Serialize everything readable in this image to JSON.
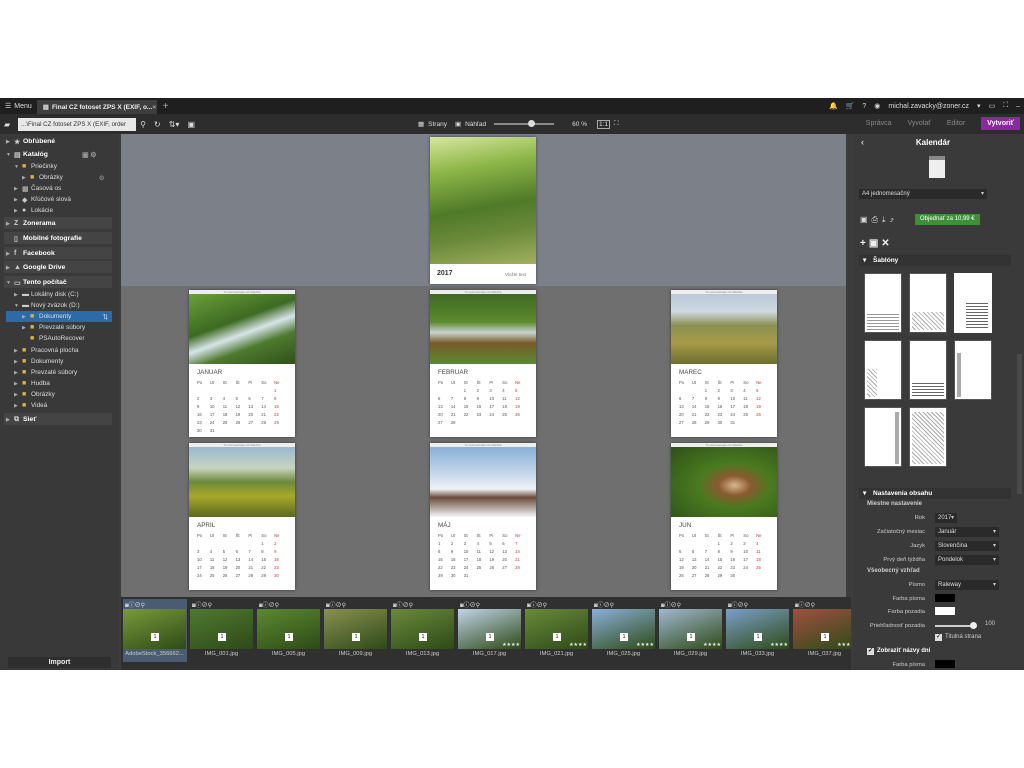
{
  "topbar": {
    "menu_label": "Menu",
    "tab_title": "Final CZ fotoset ZPS X (EXIF, o...",
    "user_email": "michal.zavacky@zoner.cz"
  },
  "toolbar": {
    "path": "...\\Final CZ fotoset ZPS X (EXIF, order",
    "pages_label": "Strany",
    "preview_label": "Náhľad",
    "zoom": "60 %",
    "modes": [
      "Správca",
      "Vyvolať",
      "Editor"
    ],
    "create_label": "Vytvoriť"
  },
  "navigator": {
    "favorites": "Obľúbené",
    "catalog": "Katalóg",
    "folders": "Priečinky",
    "pictures_sub": "Obrázky",
    "timeline": "Časová os",
    "keywords": "Kľúčové slová",
    "locations": "Lokácie",
    "zonerama": "Zonerama",
    "mobile": "Mobilné fotografie",
    "facebook": "Facebook",
    "gdrive": "Google Drive",
    "computer": "Tento počítač",
    "disk_c": "Lokálny disk (C:)",
    "new_volume": "Nový zväzok (D:)",
    "documents_sel": "Dokumenty",
    "downloads_sub": "Prevzaté súbory",
    "psauto": "PSAutoRecover",
    "desktop": "Pracovná plocha",
    "documents": "Dokumenty",
    "downloads": "Prevzaté súbory",
    "music": "Hudba",
    "pictures": "Obrázky",
    "videos": "Videá",
    "network": "Sieť",
    "import": "Import"
  },
  "calendar": {
    "cover_year": "2017",
    "cover_text": "Vložte text",
    "header_note": "Tu nezmestrujte nič dôležité",
    "weekdays": [
      "Po",
      "Ut",
      "St",
      "Št",
      "Pi",
      "So",
      "Ne"
    ],
    "months": [
      {
        "name": "JANUAR",
        "days": [
          "",
          "",
          "",
          "",
          "",
          "",
          "1",
          "2",
          "3",
          "4",
          "5",
          "6",
          "7",
          "8",
          "9",
          "10",
          "11",
          "12",
          "13",
          "14",
          "15",
          "16",
          "17",
          "18",
          "19",
          "20",
          "21",
          "22",
          "23",
          "24",
          "25",
          "26",
          "27",
          "28",
          "29",
          "30",
          "31"
        ]
      },
      {
        "name": "FEBRUAR",
        "days": [
          "",
          "",
          "1",
          "2",
          "3",
          "4",
          "5",
          "6",
          "7",
          "8",
          "9",
          "10",
          "11",
          "12",
          "13",
          "14",
          "15",
          "16",
          "17",
          "18",
          "19",
          "20",
          "21",
          "22",
          "23",
          "24",
          "25",
          "26",
          "27",
          "28"
        ]
      },
      {
        "name": "MAREC",
        "days": [
          "",
          "",
          "1",
          "2",
          "3",
          "4",
          "5",
          "6",
          "7",
          "8",
          "9",
          "10",
          "11",
          "12",
          "13",
          "14",
          "15",
          "16",
          "17",
          "18",
          "19",
          "20",
          "21",
          "22",
          "23",
          "24",
          "25",
          "26",
          "27",
          "28",
          "29",
          "30",
          "31"
        ]
      },
      {
        "name": "APRIL",
        "days": [
          "",
          "",
          "",
          "",
          "",
          "1",
          "2",
          "3",
          "4",
          "5",
          "6",
          "7",
          "8",
          "9",
          "10",
          "11",
          "12",
          "13",
          "14",
          "15",
          "16",
          "17",
          "18",
          "19",
          "20",
          "21",
          "22",
          "23",
          "24",
          "25",
          "26",
          "27",
          "28",
          "29",
          "30"
        ]
      },
      {
        "name": "MÁJ",
        "days": [
          "1",
          "2",
          "3",
          "4",
          "5",
          "6",
          "7",
          "8",
          "9",
          "10",
          "11",
          "12",
          "13",
          "14",
          "15",
          "16",
          "17",
          "18",
          "19",
          "20",
          "21",
          "22",
          "23",
          "24",
          "25",
          "26",
          "27",
          "28",
          "29",
          "30",
          "31"
        ]
      },
      {
        "name": "JUN",
        "days": [
          "",
          "",
          "",
          "1",
          "2",
          "3",
          "4",
          "5",
          "6",
          "7",
          "8",
          "9",
          "10",
          "11",
          "12",
          "13",
          "14",
          "15",
          "16",
          "17",
          "18",
          "19",
          "20",
          "21",
          "22",
          "23",
          "24",
          "25",
          "26",
          "27",
          "28",
          "29",
          "30"
        ]
      }
    ]
  },
  "filmstrip": [
    {
      "label": "AdobeStock_356662...",
      "badge": "1"
    },
    {
      "label": "IMG_001.jpg",
      "badge": "1"
    },
    {
      "label": "IMG_005.jpg",
      "badge": "1"
    },
    {
      "label": "IMG_009.jpg",
      "badge": "1"
    },
    {
      "label": "IMG_013.jpg",
      "badge": "1"
    },
    {
      "label": "IMG_017.jpg",
      "badge": "1"
    },
    {
      "label": "IMG_021.jpg",
      "badge": "1"
    },
    {
      "label": "IMG_025.jpg",
      "badge": "1"
    },
    {
      "label": "IMG_029.jpg",
      "badge": "1"
    },
    {
      "label": "IMG_033.jpg",
      "badge": "1"
    },
    {
      "label": "IMG_037.jpg",
      "badge": "1"
    }
  ],
  "right": {
    "title": "Kalendár",
    "format": "A4 jednomesačný",
    "order_label": "Objednať za 10,99 €",
    "templates_header": "Šablóny",
    "content_header": "Nastavenia obsahu",
    "local_settings": "Miestne nastavenie",
    "year_label": "Rok",
    "year_value": "2017",
    "start_month_label": "Začiatočný mesiac",
    "start_month_value": "Január",
    "language_label": "Jazyk",
    "language_value": "Slovenčina",
    "first_day_label": "Prvý deň týždňa",
    "first_day_value": "Pondelok",
    "general_look": "Všeobecný vzhľad",
    "font_label": "Písmo",
    "font_value": "Raleway",
    "font_color_label": "Farba písma",
    "bg_color_label": "Farba pozadia",
    "transparency_label": "Priehľadnosť pozadia",
    "transparency_value": "100",
    "title_page_label": "Titulná strana",
    "show_days_label": "Zobraziť názvy dní",
    "font_color2_label": "Farba písma"
  },
  "colors": {
    "accent": "#8a2aa0",
    "order": "#3f8f3a",
    "selection": "#2c6aa8"
  }
}
